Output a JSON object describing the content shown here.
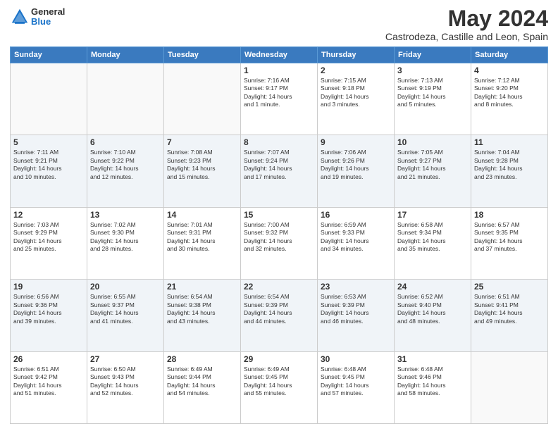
{
  "header": {
    "logo_general": "General",
    "logo_blue": "Blue",
    "month_title": "May 2024",
    "location": "Castrodeza, Castille and Leon, Spain"
  },
  "days_of_week": [
    "Sunday",
    "Monday",
    "Tuesday",
    "Wednesday",
    "Thursday",
    "Friday",
    "Saturday"
  ],
  "weeks": [
    [
      {
        "day": "",
        "info": ""
      },
      {
        "day": "",
        "info": ""
      },
      {
        "day": "",
        "info": ""
      },
      {
        "day": "1",
        "info": "Sunrise: 7:16 AM\nSunset: 9:17 PM\nDaylight: 14 hours\nand 1 minute."
      },
      {
        "day": "2",
        "info": "Sunrise: 7:15 AM\nSunset: 9:18 PM\nDaylight: 14 hours\nand 3 minutes."
      },
      {
        "day": "3",
        "info": "Sunrise: 7:13 AM\nSunset: 9:19 PM\nDaylight: 14 hours\nand 5 minutes."
      },
      {
        "day": "4",
        "info": "Sunrise: 7:12 AM\nSunset: 9:20 PM\nDaylight: 14 hours\nand 8 minutes."
      }
    ],
    [
      {
        "day": "5",
        "info": "Sunrise: 7:11 AM\nSunset: 9:21 PM\nDaylight: 14 hours\nand 10 minutes."
      },
      {
        "day": "6",
        "info": "Sunrise: 7:10 AM\nSunset: 9:22 PM\nDaylight: 14 hours\nand 12 minutes."
      },
      {
        "day": "7",
        "info": "Sunrise: 7:08 AM\nSunset: 9:23 PM\nDaylight: 14 hours\nand 15 minutes."
      },
      {
        "day": "8",
        "info": "Sunrise: 7:07 AM\nSunset: 9:24 PM\nDaylight: 14 hours\nand 17 minutes."
      },
      {
        "day": "9",
        "info": "Sunrise: 7:06 AM\nSunset: 9:26 PM\nDaylight: 14 hours\nand 19 minutes."
      },
      {
        "day": "10",
        "info": "Sunrise: 7:05 AM\nSunset: 9:27 PM\nDaylight: 14 hours\nand 21 minutes."
      },
      {
        "day": "11",
        "info": "Sunrise: 7:04 AM\nSunset: 9:28 PM\nDaylight: 14 hours\nand 23 minutes."
      }
    ],
    [
      {
        "day": "12",
        "info": "Sunrise: 7:03 AM\nSunset: 9:29 PM\nDaylight: 14 hours\nand 25 minutes."
      },
      {
        "day": "13",
        "info": "Sunrise: 7:02 AM\nSunset: 9:30 PM\nDaylight: 14 hours\nand 28 minutes."
      },
      {
        "day": "14",
        "info": "Sunrise: 7:01 AM\nSunset: 9:31 PM\nDaylight: 14 hours\nand 30 minutes."
      },
      {
        "day": "15",
        "info": "Sunrise: 7:00 AM\nSunset: 9:32 PM\nDaylight: 14 hours\nand 32 minutes."
      },
      {
        "day": "16",
        "info": "Sunrise: 6:59 AM\nSunset: 9:33 PM\nDaylight: 14 hours\nand 34 minutes."
      },
      {
        "day": "17",
        "info": "Sunrise: 6:58 AM\nSunset: 9:34 PM\nDaylight: 14 hours\nand 35 minutes."
      },
      {
        "day": "18",
        "info": "Sunrise: 6:57 AM\nSunset: 9:35 PM\nDaylight: 14 hours\nand 37 minutes."
      }
    ],
    [
      {
        "day": "19",
        "info": "Sunrise: 6:56 AM\nSunset: 9:36 PM\nDaylight: 14 hours\nand 39 minutes."
      },
      {
        "day": "20",
        "info": "Sunrise: 6:55 AM\nSunset: 9:37 PM\nDaylight: 14 hours\nand 41 minutes."
      },
      {
        "day": "21",
        "info": "Sunrise: 6:54 AM\nSunset: 9:38 PM\nDaylight: 14 hours\nand 43 minutes."
      },
      {
        "day": "22",
        "info": "Sunrise: 6:54 AM\nSunset: 9:39 PM\nDaylight: 14 hours\nand 44 minutes."
      },
      {
        "day": "23",
        "info": "Sunrise: 6:53 AM\nSunset: 9:39 PM\nDaylight: 14 hours\nand 46 minutes."
      },
      {
        "day": "24",
        "info": "Sunrise: 6:52 AM\nSunset: 9:40 PM\nDaylight: 14 hours\nand 48 minutes."
      },
      {
        "day": "25",
        "info": "Sunrise: 6:51 AM\nSunset: 9:41 PM\nDaylight: 14 hours\nand 49 minutes."
      }
    ],
    [
      {
        "day": "26",
        "info": "Sunrise: 6:51 AM\nSunset: 9:42 PM\nDaylight: 14 hours\nand 51 minutes."
      },
      {
        "day": "27",
        "info": "Sunrise: 6:50 AM\nSunset: 9:43 PM\nDaylight: 14 hours\nand 52 minutes."
      },
      {
        "day": "28",
        "info": "Sunrise: 6:49 AM\nSunset: 9:44 PM\nDaylight: 14 hours\nand 54 minutes."
      },
      {
        "day": "29",
        "info": "Sunrise: 6:49 AM\nSunset: 9:45 PM\nDaylight: 14 hours\nand 55 minutes."
      },
      {
        "day": "30",
        "info": "Sunrise: 6:48 AM\nSunset: 9:45 PM\nDaylight: 14 hours\nand 57 minutes."
      },
      {
        "day": "31",
        "info": "Sunrise: 6:48 AM\nSunset: 9:46 PM\nDaylight: 14 hours\nand 58 minutes."
      },
      {
        "day": "",
        "info": ""
      }
    ]
  ]
}
